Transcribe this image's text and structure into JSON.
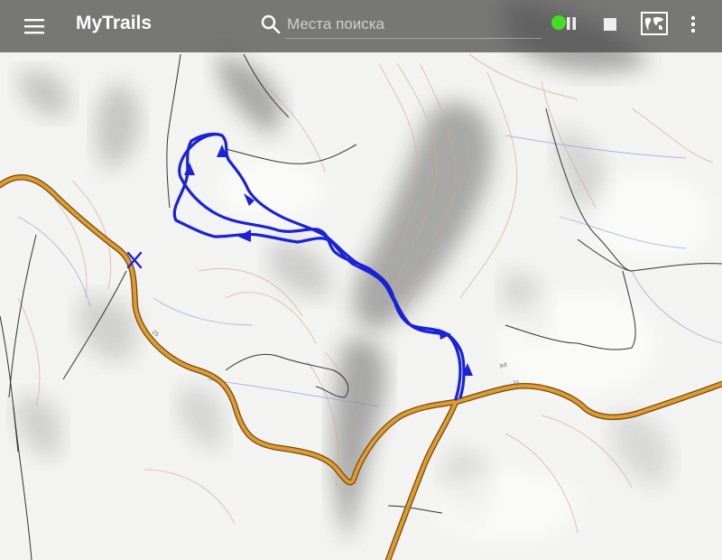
{
  "app": {
    "title": "MyTrails"
  },
  "search": {
    "placeholder": "Места поиска"
  },
  "icons": {
    "menu": "hamburger-menu-icon",
    "search": "search-icon",
    "recording_status": "recording-status-dot-icon",
    "pause": "pause-icon",
    "stop": "stop-icon",
    "map_layers": "world-map-layers-icon",
    "overflow": "more-vert-icon"
  },
  "colors": {
    "toolbar": "#4a4a4a",
    "track": "#1a22d6",
    "recording": "#44dd22",
    "road": "#e39a2c",
    "contour": "#d3a988",
    "water": "#7d8cd6"
  },
  "map": {
    "road_labels": [
      "25",
      "25",
      "Rd"
    ],
    "track_start_marker": "X"
  }
}
